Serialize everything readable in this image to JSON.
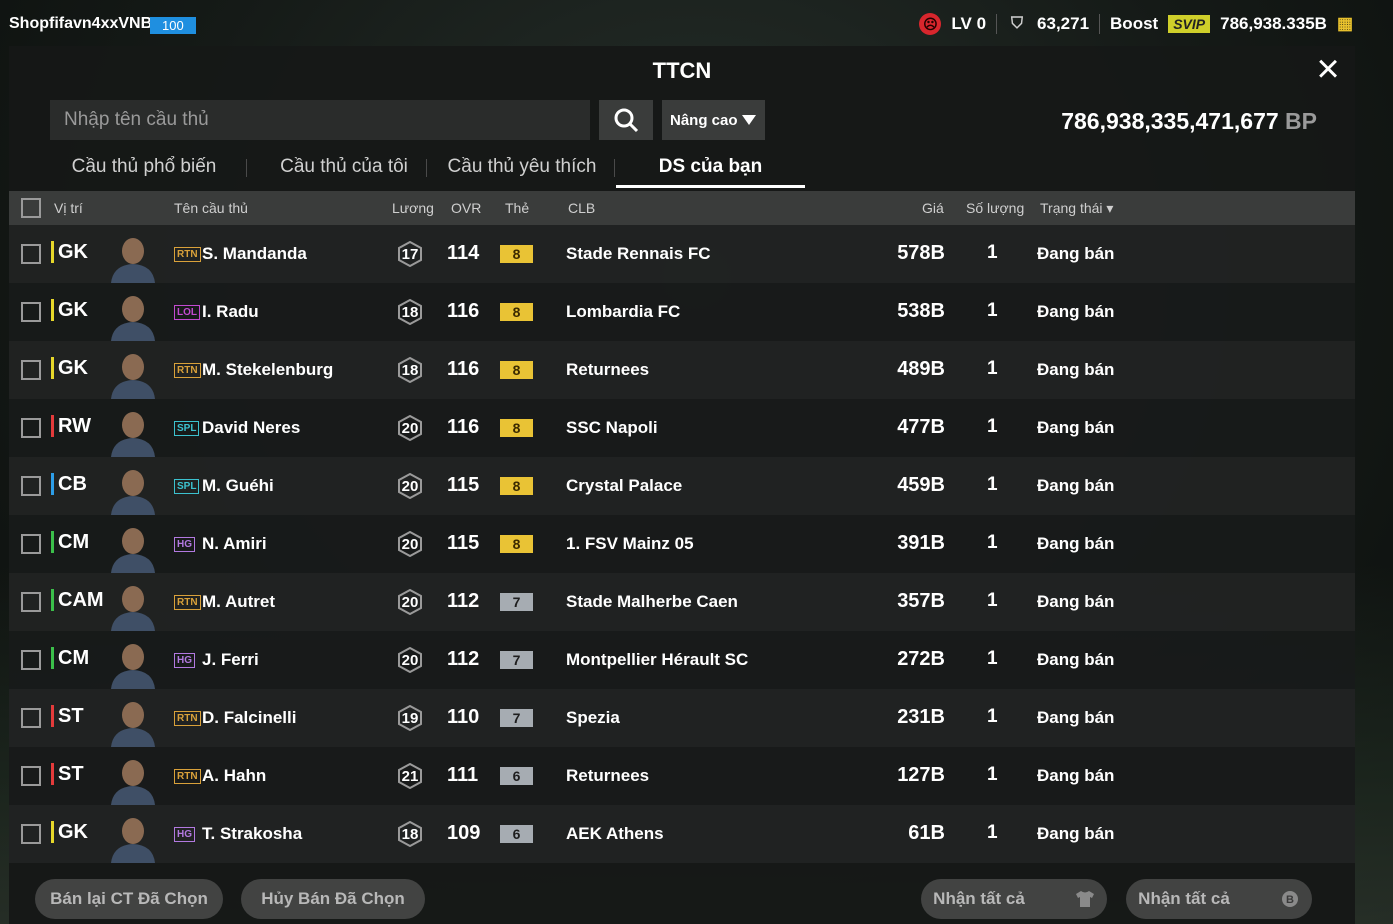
{
  "topbar": {
    "username": "Shopfifavn4xxVNB",
    "user_level": "100",
    "lv": "LV 0",
    "coins": "63,271",
    "boost": "Boost",
    "svip": "SVIP",
    "bp": "786,938.335B"
  },
  "panel": {
    "title": "TTCN",
    "search_placeholder": "Nhập tên cầu thủ",
    "advanced": "Nâng cao",
    "bp_total": "786,938,335,471,677",
    "bp_unit": "BP"
  },
  "tabs": [
    {
      "label": "Cầu thủ phổ biến"
    },
    {
      "label": "Cầu thủ của tôi"
    },
    {
      "label": "Cầu thủ yêu thích"
    },
    {
      "label": "DS của bạn"
    }
  ],
  "columns": {
    "position": "Vị trí",
    "name": "Tên cầu thủ",
    "salary": "Lương",
    "ovr": "OVR",
    "card": "Thẻ",
    "club": "CLB",
    "price": "Giá",
    "qty": "Số lượng",
    "status": "Trạng thái"
  },
  "rows": [
    {
      "pos": "GK",
      "season": "RTN",
      "name": "S. Mandanda",
      "salary": "17",
      "ovr": "114",
      "card": "8",
      "club": "Stade Rennais FC",
      "price": "578B",
      "qty": "1",
      "status": "Đang bán"
    },
    {
      "pos": "GK",
      "season": "LOL",
      "name": "I. Radu",
      "salary": "18",
      "ovr": "116",
      "card": "8",
      "club": "Lombardia FC",
      "price": "538B",
      "qty": "1",
      "status": "Đang bán"
    },
    {
      "pos": "GK",
      "season": "RTN",
      "name": "M. Stekelenburg",
      "salary": "18",
      "ovr": "116",
      "card": "8",
      "club": "Returnees",
      "price": "489B",
      "qty": "1",
      "status": "Đang bán"
    },
    {
      "pos": "RW",
      "season": "SPL",
      "name": "David Neres",
      "salary": "20",
      "ovr": "116",
      "card": "8",
      "club": "SSC Napoli",
      "price": "477B",
      "qty": "1",
      "status": "Đang bán"
    },
    {
      "pos": "CB",
      "season": "SPL",
      "name": "M. Guéhi",
      "salary": "20",
      "ovr": "115",
      "card": "8",
      "club": "Crystal Palace",
      "price": "459B",
      "qty": "1",
      "status": "Đang bán"
    },
    {
      "pos": "CM",
      "season": "HG",
      "name": "N. Amiri",
      "salary": "20",
      "ovr": "115",
      "card": "8",
      "club": "1. FSV Mainz 05",
      "price": "391B",
      "qty": "1",
      "status": "Đang bán"
    },
    {
      "pos": "CAM",
      "season": "RTN",
      "name": "M. Autret",
      "salary": "20",
      "ovr": "112",
      "card": "7",
      "club": "Stade Malherbe Caen",
      "price": "357B",
      "qty": "1",
      "status": "Đang bán"
    },
    {
      "pos": "CM",
      "season": "HG",
      "name": "J. Ferri",
      "salary": "20",
      "ovr": "112",
      "card": "7",
      "club": "Montpellier Hérault SC",
      "price": "272B",
      "qty": "1",
      "status": "Đang bán"
    },
    {
      "pos": "ST",
      "season": "RTN",
      "name": "D. Falcinelli",
      "salary": "19",
      "ovr": "110",
      "card": "7",
      "club": "Spezia",
      "price": "231B",
      "qty": "1",
      "status": "Đang bán"
    },
    {
      "pos": "ST",
      "season": "RTN",
      "name": "A. Hahn",
      "salary": "21",
      "ovr": "111",
      "card": "6",
      "club": "Returnees",
      "price": "127B",
      "qty": "1",
      "status": "Đang bán"
    },
    {
      "pos": "GK",
      "season": "HG",
      "name": "T. Strakosha",
      "salary": "18",
      "ovr": "109",
      "card": "6",
      "club": "AEK Athens",
      "price": "61B",
      "qty": "1",
      "status": "Đang bán"
    }
  ],
  "footer": {
    "resell": "Bán lại CT Đã Chọn",
    "cancel": "Hủy Bán Đã Chọn",
    "receive_all_1": "Nhận tất cả",
    "receive_all_2": "Nhận tất cả"
  },
  "colors": {
    "gk": "#e6d72a",
    "fw": "#e43b3b",
    "df": "#2d9ee8",
    "mf": "#3bbf4a",
    "gold_card": "#e9c335",
    "silver_card": "#a6acb2",
    "season_rtn": "#d9a13a",
    "season_lol": "#c34ad1",
    "season_spl": "#3cc2cf",
    "season_hg": "#b279e0"
  }
}
